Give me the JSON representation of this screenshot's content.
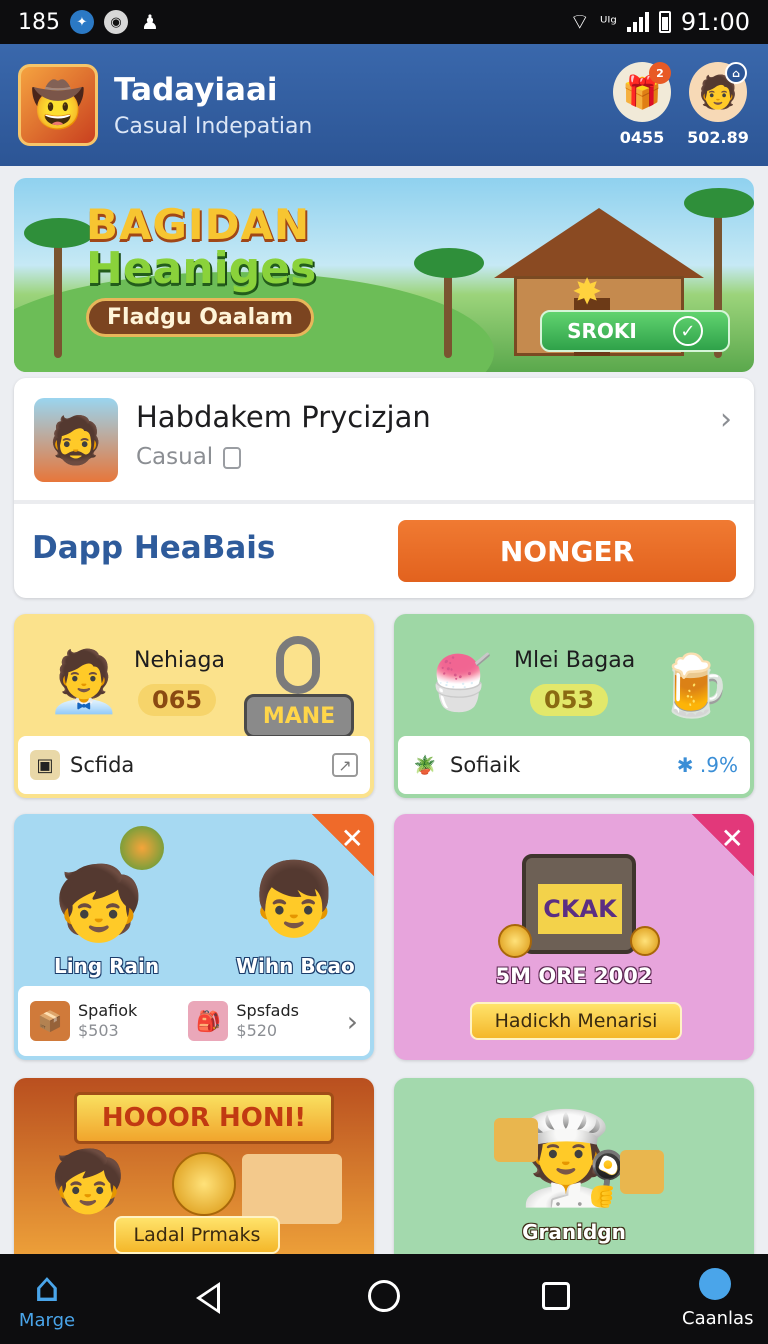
{
  "status_bar": {
    "left_text": "185",
    "time": "91:00",
    "network_label": "ᵁᴵᵍ"
  },
  "header": {
    "title": "Tadayiaai",
    "subtitle": "Casual Indepatian",
    "stats": [
      {
        "value": "0455",
        "icon": "gift-icon"
      },
      {
        "value": "502.89",
        "icon": "avatar-icon"
      }
    ]
  },
  "banner": {
    "title_line1": "BAGIDAN",
    "title_line2": "Heaniges",
    "title_line3": "Fladgu Oaalam",
    "button_label": "SROKI"
  },
  "feature": {
    "name": "Habdakem Prycizjan",
    "category": "Casual",
    "link_text": "Dapp HeaBais",
    "button_label": "NONGER"
  },
  "tiles": [
    {
      "label": "Nehiaga",
      "badge": "065",
      "plate": "MANE",
      "footer": "Scfida"
    },
    {
      "label": "Mlei Bagaa",
      "badge": "053",
      "footer": "Sofiaik",
      "stat": ".9%"
    },
    {
      "characters": [
        "Ling Rain",
        "Wihn Bcao"
      ],
      "minis": [
        {
          "title": "Spafiok",
          "price": "$503"
        },
        {
          "title": "Spsfads",
          "price": "$520"
        }
      ]
    },
    {
      "chest_label": "CKAK",
      "date": "5M ORE 2002",
      "button_label": "Hadickh Menarisi"
    },
    {
      "banner": "HOOOR HONI!",
      "button_label": "Ladal Prmaks"
    },
    {
      "label": "Granidgn"
    }
  ],
  "nav": {
    "home_label": "Marge",
    "profile_label": "Caanlas"
  },
  "colors": {
    "header": "#2c5595",
    "accent_orange": "#e8692a",
    "link_blue": "#2e5b9b",
    "nav_active": "#4aa5ea"
  }
}
